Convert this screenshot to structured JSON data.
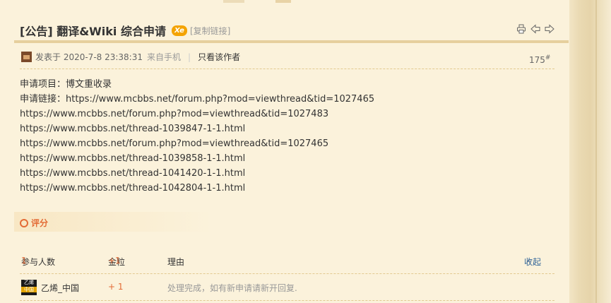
{
  "post": {
    "title": "[公告] 翻译&Wiki 综合申请",
    "badge": "Xe",
    "copy_link": "[复制链接]",
    "meta": {
      "posted": "发表于 2020-7-8 23:38:31",
      "source": "来自手机",
      "separator": "|",
      "author_only": "只看该作者"
    },
    "floor": "175",
    "floor_mark": "#",
    "lines": [
      "申请项目：博文重收录",
      "申请链接：https://www.mcbbs.net/forum.php?mod=viewthread&tid=1027465",
      "https://www.mcbbs.net/forum.php?mod=viewthread&tid=1027483",
      "https://www.mcbbs.net/thread-1039847-1-1.html",
      "https://www.mcbbs.net/forum.php?mod=viewthread&tid=1027465",
      "https://www.mcbbs.net/thread-1039858-1-1.html",
      "https://www.mcbbs.net/thread-1041420-1-1.html",
      "https://www.mcbbs.net/thread-1042804-1-1.html"
    ]
  },
  "rating": {
    "label": "评分",
    "participants_label": "参与人数",
    "participants_count": "1",
    "gold_label": "金粒",
    "gold_total": "+1",
    "reason_label": "理由",
    "collapse": "收起",
    "rows": [
      {
        "avatar_text_top": "乙烯",
        "avatar_text_bottom": "中国",
        "user": "乙烯_中国",
        "amount": "+ 1",
        "reason": "处理完成，如有新申请请新开回复."
      }
    ]
  },
  "icons": [
    "print-icon",
    "prev-thread-icon",
    "next-thread-icon",
    "user-avatar-icon",
    "chevron-up-icon"
  ],
  "colors": {
    "background": "#fbf2db",
    "accent": "#e36b36",
    "link": "#336699"
  }
}
